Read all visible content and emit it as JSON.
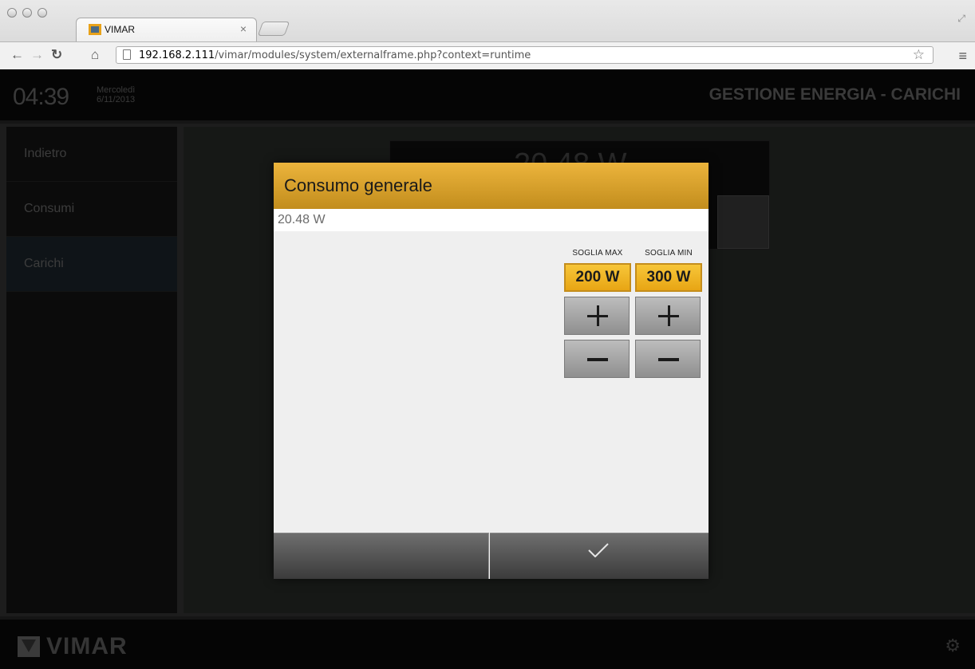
{
  "browser": {
    "tab_title": "VIMAR",
    "tab_close": "×",
    "url_host": "192.168.2.111",
    "url_path": "/vimar/modules/system/externalframe.php?context=runtime"
  },
  "header": {
    "time": "04:39",
    "day": "Mercoledì",
    "date": "6/11/2013",
    "title": "GESTIONE ENERGIA - CARICHI"
  },
  "sidebar": {
    "items": [
      {
        "label": "Indietro"
      },
      {
        "label": "Consumi"
      },
      {
        "label": "Carichi"
      }
    ]
  },
  "background": {
    "value": "20.48 W"
  },
  "dialog": {
    "title": "Consumo generale",
    "value": "20.48 W",
    "soglia_max": {
      "label": "SOGLIA MAX",
      "value": "200 W"
    },
    "soglia_min": {
      "label": "SOGLIA MIN",
      "value": "300 W"
    }
  },
  "footer": {
    "brand": "VIMAR"
  },
  "colors": {
    "accent": "#e8a514",
    "header_gold": "#c28d1d"
  }
}
